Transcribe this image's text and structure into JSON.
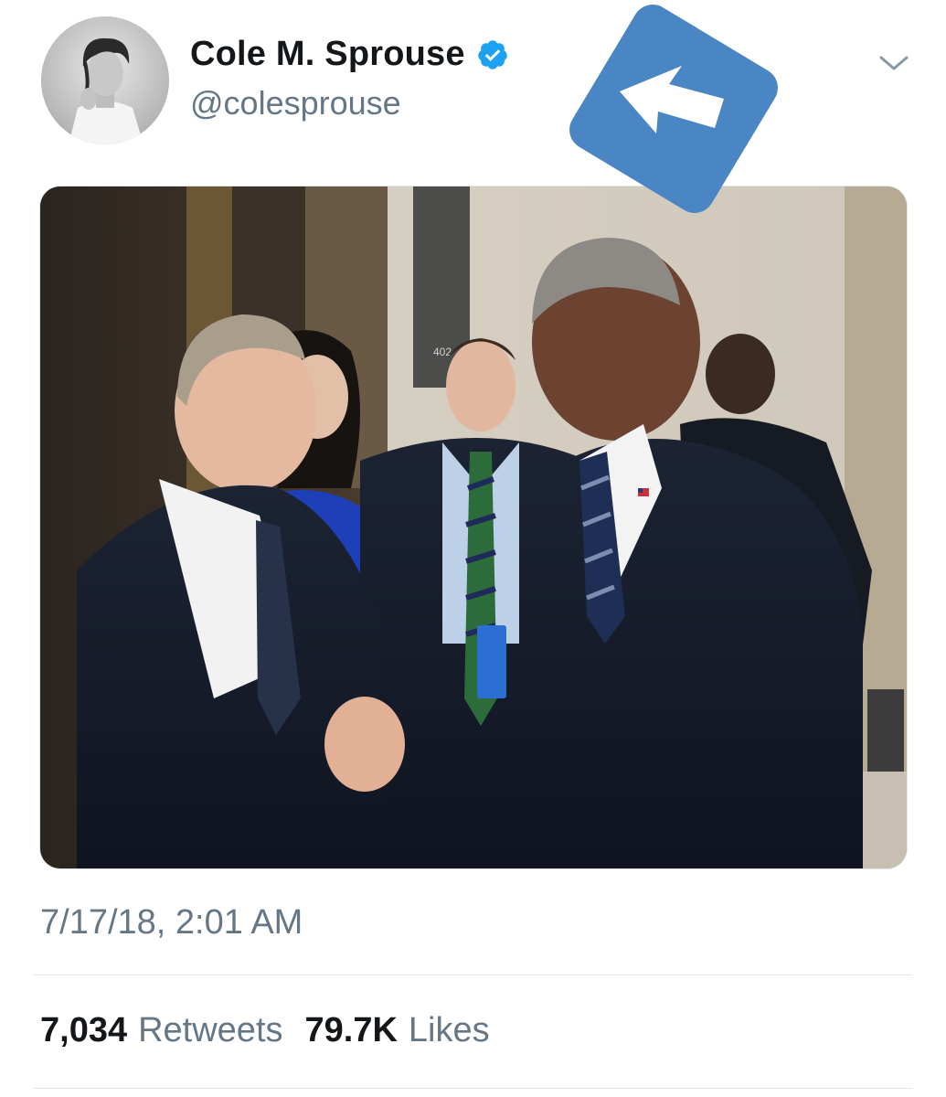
{
  "tweet": {
    "author": {
      "display_name": "Cole M. Sprouse",
      "handle": "@colesprouse",
      "verified": true,
      "avatar_icon": "profile-photo"
    },
    "menu_icon": "chevron-down-icon",
    "overlay_icon": "arrow-up-left-icon",
    "media": {
      "type": "photo",
      "badge_text": "402"
    },
    "timestamp": "7/17/18, 2:01 AM",
    "stats": {
      "retweets_count": "7,034",
      "retweets_label": "Retweets",
      "likes_count": "79.7K",
      "likes_label": "Likes"
    }
  },
  "colors": {
    "text_primary": "#14171a",
    "text_secondary": "#657786",
    "verified_blue": "#1da1f2",
    "overlay_blue": "#4a86c4",
    "divider": "#e1e8ed"
  }
}
